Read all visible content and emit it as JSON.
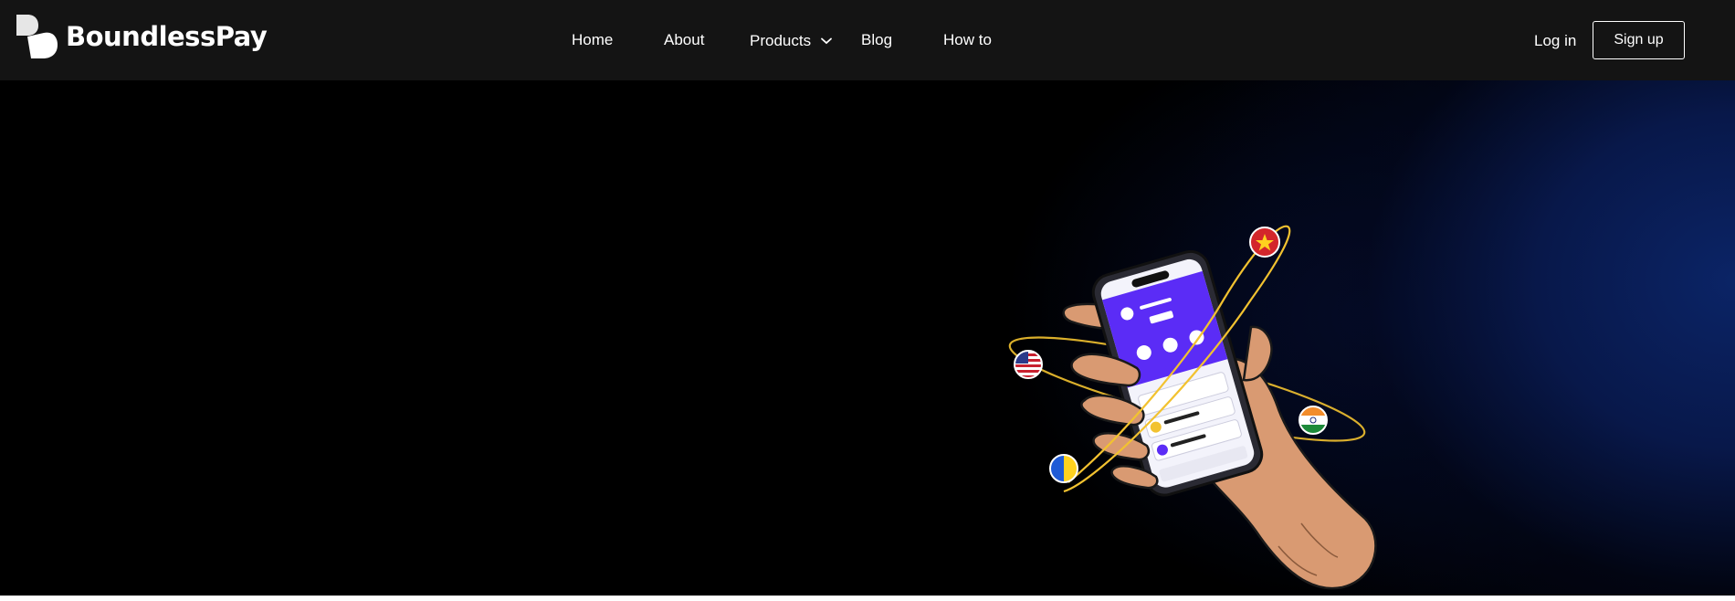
{
  "brand": {
    "name": "BoundlessPay"
  },
  "nav": {
    "home": "Home",
    "about": "About",
    "products": "Products",
    "blog": "Blog",
    "howto": "How to"
  },
  "auth": {
    "login": "Log in",
    "signup": "Sign up"
  },
  "icons": {
    "logo": "boundlesspay-logo-icon",
    "dropdown": "chevron-down-icon",
    "flags": [
      "usa-flag-icon",
      "vietnam-flag-icon",
      "india-flag-icon",
      "ukraine-flag-icon"
    ]
  },
  "colors": {
    "header_bg": "#141414",
    "hero_bg": "#000000",
    "hero_glow": "#0b2466",
    "phone_screen_accent": "#5b2cf6",
    "orbit": "#f2c230",
    "hand": "#d99a72"
  }
}
